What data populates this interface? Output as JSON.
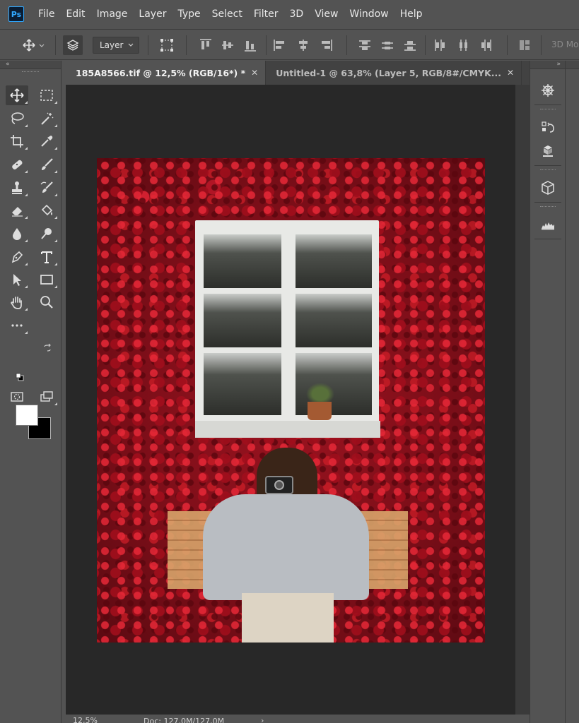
{
  "app": {
    "logo_text": "Ps"
  },
  "menu": [
    "File",
    "Edit",
    "Image",
    "Layer",
    "Type",
    "Select",
    "Filter",
    "3D",
    "View",
    "Window",
    "Help"
  ],
  "options_bar": {
    "auto_select_target": "Layer",
    "mode_3d_label": "3D Mo"
  },
  "tabs": [
    {
      "label": "185A8566.tif @ 12,5% (RGB/16*) *",
      "active": true
    },
    {
      "label": "Untitled-1 @ 63,8% (Layer 5, RGB/8#/CMYK...",
      "active": false
    }
  ],
  "colors": {
    "foreground": "#ffffff",
    "background": "#000000"
  },
  "status": {
    "zoom": "12,5%",
    "doc_info": "Doc: 127,0M/127,0M"
  },
  "tools": [
    "move-tool",
    "marquee-tool",
    "lasso-tool",
    "magic-wand-tool",
    "crop-tool",
    "eyedropper-tool",
    "healing-brush-tool",
    "brush-tool",
    "clone-stamp-tool",
    "history-brush-tool",
    "eraser-tool",
    "paint-bucket-tool",
    "blur-tool",
    "dodge-tool",
    "pen-tool",
    "type-tool",
    "path-selection-tool",
    "rectangle-tool",
    "hand-tool",
    "zoom-tool",
    "edit-toolbar",
    "quick-mask",
    "screen-mode"
  ]
}
